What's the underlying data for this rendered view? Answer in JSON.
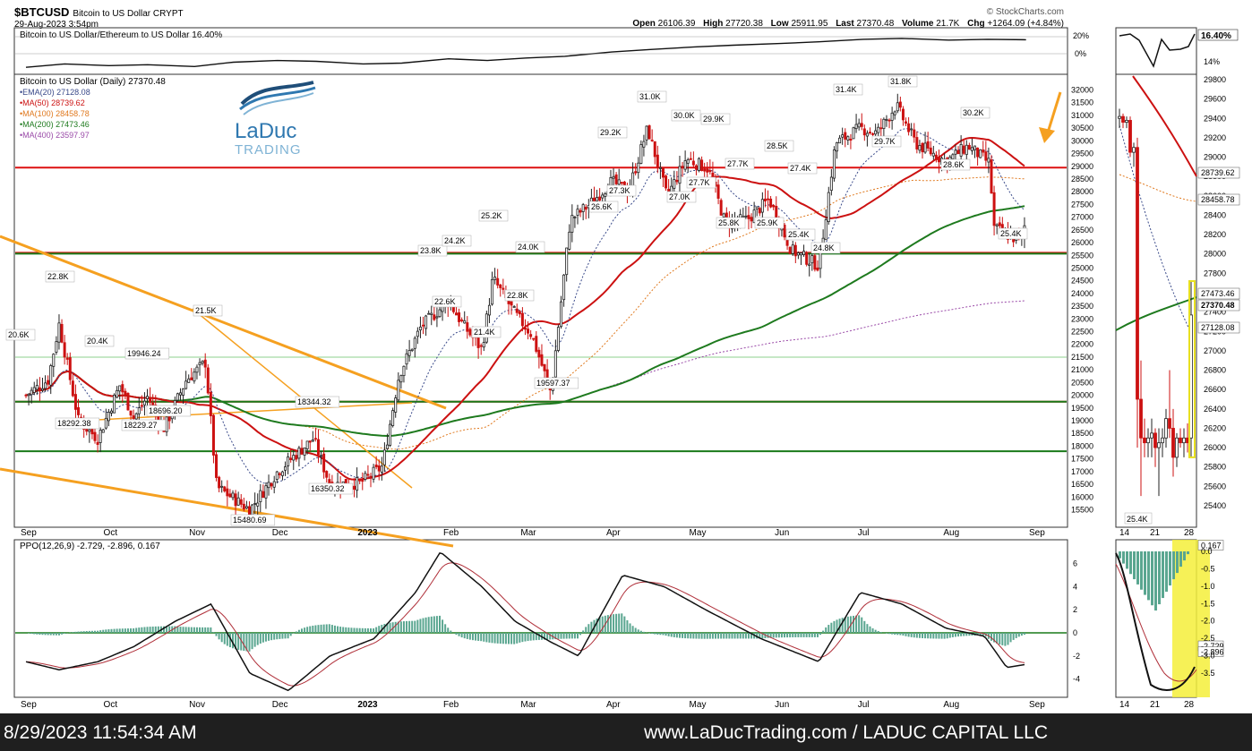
{
  "header": {
    "symbol": "$BTCUSD",
    "name": "Bitcoin to US Dollar",
    "exchange": "CRYPT",
    "date": "29-Aug-2023 3:54pm",
    "source": "© StockCharts.com",
    "ohlc": {
      "open": "26106.39",
      "high": "27720.38",
      "low": "25911.95",
      "last": "27370.48",
      "volume": "21.7K",
      "chg": "+1264.09 (+4.84%)"
    }
  },
  "logo": {
    "line1": "LaDuc",
    "line2": "TRADING"
  },
  "footer": {
    "timestamp": "8/29/2023 11:54:34 AM",
    "site": "www.LaDucTrading.com / LADUC CAPITAL LLC"
  },
  "colors": {
    "up": "#222222",
    "down": "#cc1111",
    "ema20": "#3a4a8a",
    "ma50": "#cc1111",
    "ma100": "#e07a20",
    "ma200": "#1e7a1e",
    "ma400": "#9a4aa8",
    "orange": "#f5a020",
    "hist": "#5aa690",
    "highlight": "#f5ef3a"
  },
  "chart_data": [
    {
      "type": "line",
      "panel": "ratio",
      "title": "Bitcoin to US Dollar/Ethereum to US Dollar 16.40%",
      "series": [
        {
          "name": "BTC/ETH",
          "x": [
            "2022-09-01",
            "2022-09-15",
            "2022-10-01",
            "2022-10-15",
            "2022-11-01",
            "2022-11-15",
            "2022-12-01",
            "2022-12-15",
            "2023-01-01",
            "2023-01-15",
            "2023-02-01",
            "2023-02-15",
            "2023-03-01",
            "2023-03-15",
            "2023-04-01",
            "2023-04-15",
            "2023-05-01",
            "2023-05-15",
            "2023-06-01",
            "2023-06-15",
            "2023-07-01",
            "2023-07-15",
            "2023-08-01",
            "2023-08-15",
            "2023-08-29"
          ],
          "values": [
            -16,
            -12,
            -14,
            -13,
            -15,
            -10,
            -8,
            -9,
            -12,
            -11,
            -6,
            -8,
            -5,
            -3,
            2,
            5,
            8,
            10,
            12,
            14,
            17,
            18,
            16,
            17,
            16.4
          ]
        }
      ],
      "yticks": [
        "20%",
        "0%"
      ],
      "last_label": "16.40%",
      "zoom_yticks": [
        "16.40%",
        "14%"
      ]
    },
    {
      "type": "candlestick",
      "panel": "price",
      "title": "Bitcoin to US Dollar (Daily) 27370.48",
      "legend": [
        {
          "label": "EMA(20) 27128.08",
          "color": "#3a4a8a"
        },
        {
          "label": "MA(50) 28739.62",
          "color": "#cc1111"
        },
        {
          "label": "MA(100) 28458.78",
          "color": "#e07a20"
        },
        {
          "label": "MA(200) 27473.46",
          "color": "#1e7a1e"
        },
        {
          "label": "MA(400) 23597.97",
          "color": "#9a4aa8"
        }
      ],
      "x_labels": [
        "Sep",
        "Oct",
        "Nov",
        "Dec",
        "2023",
        "Feb",
        "Mar",
        "Apr",
        "May",
        "Jun",
        "Jul",
        "Aug",
        "Sep"
      ],
      "yticks": [
        "32000",
        "31500",
        "31000",
        "30500",
        "30000",
        "29500",
        "29000",
        "28500",
        "28000",
        "27500",
        "27000",
        "26500",
        "26000",
        "25500",
        "25000",
        "24500",
        "24000",
        "23500",
        "23000",
        "22500",
        "22000",
        "21500",
        "21000",
        "20500",
        "20000",
        "19500",
        "19000",
        "18500",
        "18000",
        "17500",
        "17000",
        "16500",
        "16000",
        "15500"
      ],
      "ylim": [
        15000,
        32500
      ],
      "close_points": [
        {
          "date": "2022-09-01",
          "close": 20000
        },
        {
          "date": "2022-09-09",
          "close": 20600
        },
        {
          "date": "2022-09-13",
          "close": 22800
        },
        {
          "date": "2022-09-20",
          "close": 19000
        },
        {
          "date": "2022-09-27",
          "close": 18300
        },
        {
          "date": "2022-10-05",
          "close": 20400
        },
        {
          "date": "2022-10-10",
          "close": 19100
        },
        {
          "date": "2022-10-15",
          "close": 19950
        },
        {
          "date": "2022-10-21",
          "close": 18700
        },
        {
          "date": "2022-10-29",
          "close": 20600
        },
        {
          "date": "2022-11-05",
          "close": 21300
        },
        {
          "date": "2022-11-09",
          "close": 16400
        },
        {
          "date": "2022-11-21",
          "close": 15500
        },
        {
          "date": "2022-12-01",
          "close": 17000
        },
        {
          "date": "2022-12-14",
          "close": 18300
        },
        {
          "date": "2022-12-20",
          "close": 16500
        },
        {
          "date": "2022-12-31",
          "close": 16550
        },
        {
          "date": "2023-01-08",
          "close": 17200
        },
        {
          "date": "2023-01-14",
          "close": 20800
        },
        {
          "date": "2023-01-22",
          "close": 22700
        },
        {
          "date": "2023-02-01",
          "close": 23700
        },
        {
          "date": "2023-02-06",
          "close": 22800
        },
        {
          "date": "2023-02-13",
          "close": 21800
        },
        {
          "date": "2023-02-17",
          "close": 24600
        },
        {
          "date": "2023-02-25",
          "close": 23200
        },
        {
          "date": "2023-03-03",
          "close": 22400
        },
        {
          "date": "2023-03-10",
          "close": 20100
        },
        {
          "date": "2023-03-17",
          "close": 26900
        },
        {
          "date": "2023-03-24",
          "close": 27500
        },
        {
          "date": "2023-04-01",
          "close": 28400
        },
        {
          "date": "2023-04-07",
          "close": 28000
        },
        {
          "date": "2023-04-14",
          "close": 30500
        },
        {
          "date": "2023-04-21",
          "close": 27800
        },
        {
          "date": "2023-04-28",
          "close": 29300
        },
        {
          "date": "2023-05-06",
          "close": 28900
        },
        {
          "date": "2023-05-12",
          "close": 26800
        },
        {
          "date": "2023-05-20",
          "close": 26900
        },
        {
          "date": "2023-05-28",
          "close": 27700
        },
        {
          "date": "2023-06-05",
          "close": 25700
        },
        {
          "date": "2023-06-15",
          "close": 25100
        },
        {
          "date": "2023-06-21",
          "close": 29900
        },
        {
          "date": "2023-06-30",
          "close": 30500
        },
        {
          "date": "2023-07-06",
          "close": 30300
        },
        {
          "date": "2023-07-13",
          "close": 31400
        },
        {
          "date": "2023-07-20",
          "close": 29900
        },
        {
          "date": "2023-07-31",
          "close": 29200
        },
        {
          "date": "2023-08-08",
          "close": 29800
        },
        {
          "date": "2023-08-16",
          "close": 29100
        },
        {
          "date": "2023-08-17",
          "close": 26600
        },
        {
          "date": "2023-08-24",
          "close": 26200
        },
        {
          "date": "2023-08-28",
          "close": 26100
        },
        {
          "date": "2023-08-29",
          "close": 27370
        }
      ],
      "annotations": [
        "20.6K",
        "22.8K",
        "20.4K",
        "19946.24",
        "21.5K",
        "18292.38",
        "18229.27",
        "18696.20",
        "18344.32",
        "15480.69",
        "16350.32",
        "23.8K",
        "24.2K",
        "25.2K",
        "22.6K",
        "21.4K",
        "24.0K",
        "22.8K",
        "19597.37",
        "29.2K",
        "27.3K",
        "26.6K",
        "31.0K",
        "30.0K",
        "29.9K",
        "27.0K",
        "27.7K",
        "27.7K",
        "25.8K",
        "28.5K",
        "25.9K",
        "27.4K",
        "25.4K",
        "24.8K",
        "31.4K",
        "31.8K",
        "29.7K",
        "30.2K",
        "28.6K",
        "25.4K"
      ],
      "horizontal_lines": [
        {
          "value": 28950,
          "color": "red"
        },
        {
          "value": 25600,
          "color": "red"
        },
        {
          "value": 25600,
          "color": "green"
        },
        {
          "value": 21500,
          "color": "lightgreen"
        },
        {
          "value": 19750,
          "color": "red"
        },
        {
          "value": 19750,
          "color": "green"
        },
        {
          "value": 17800,
          "color": "green"
        }
      ],
      "zoom_yticks": [
        "29800",
        "29600",
        "29400",
        "29200",
        "29000",
        "28800",
        "28600",
        "28400",
        "28200",
        "28000",
        "27800",
        "27600",
        "27400",
        "27200",
        "27000",
        "26800",
        "26600",
        "26400",
        "26200",
        "26000",
        "25800",
        "25600",
        "25400"
      ],
      "zoom_labels": [
        "28739.62",
        "28458.78",
        "27473.46",
        "27370.48",
        "27128.08"
      ],
      "zoom_low_label": "25.4K",
      "zoom_x_labels": [
        "14",
        "21",
        "28"
      ]
    },
    {
      "type": "line",
      "panel": "ppo",
      "title": "PPO(12,26,9) -2.729, -2.896, 0.167",
      "yticks": [
        "6",
        "4",
        "2",
        "0",
        "-2",
        "-4"
      ],
      "ylim": [
        -5,
        7.5
      ],
      "series": [
        {
          "name": "PPO",
          "x": [
            "2022-09-01",
            "2022-09-13",
            "2022-09-27",
            "2022-10-10",
            "2022-10-25",
            "2022-11-07",
            "2022-11-21",
            "2022-12-05",
            "2022-12-20",
            "2023-01-05",
            "2023-01-20",
            "2023-01-29",
            "2023-02-13",
            "2023-02-25",
            "2023-03-10",
            "2023-03-20",
            "2023-04-05",
            "2023-04-20",
            "2023-05-05",
            "2023-05-25",
            "2023-06-15",
            "2023-06-30",
            "2023-07-15",
            "2023-07-31",
            "2023-08-14",
            "2023-08-22",
            "2023-08-29"
          ],
          "values": [
            -2.5,
            -3.2,
            -2.5,
            -1.2,
            1.0,
            2.5,
            -3.5,
            -5.0,
            -2.0,
            -0.5,
            3.5,
            7.0,
            4.0,
            1.0,
            -0.8,
            -2.0,
            5.0,
            4.0,
            2.0,
            -0.5,
            -2.5,
            3.5,
            2.5,
            0.4,
            -0.3,
            -3.0,
            -2.729
          ]
        },
        {
          "name": "Signal",
          "values_note": "smoothed",
          "last": -2.896
        },
        {
          "name": "Histogram",
          "last": 0.167
        }
      ],
      "zoom_yticks": [
        "0.167",
        "0.0",
        "-0.5",
        "-1.0",
        "-1.5",
        "-2.0",
        "-2.5",
        "-2.729",
        "-2.896",
        "-3.0",
        "-3.5"
      ],
      "zoom_x_labels": [
        "14",
        "21",
        "28"
      ]
    }
  ]
}
